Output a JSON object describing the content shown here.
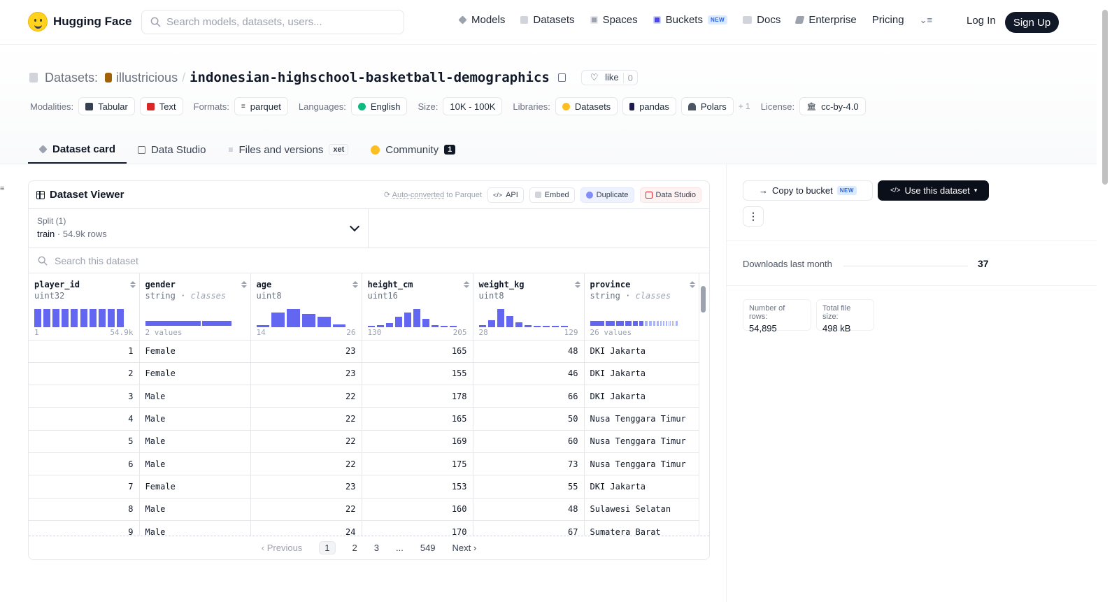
{
  "nav": {
    "brand": "Hugging Face",
    "search_placeholder": "Search models, datasets, users...",
    "links": [
      {
        "label": "Models",
        "icon": "models-icon"
      },
      {
        "label": "Datasets",
        "icon": "datasets-icon"
      },
      {
        "label": "Spaces",
        "icon": "spaces-icon"
      },
      {
        "label": "Buckets",
        "icon": "buckets-icon",
        "badge": "NEW"
      },
      {
        "label": "Docs",
        "icon": "docs-icon"
      },
      {
        "label": "Enterprise",
        "icon": "enterprise-icon"
      },
      {
        "label": "Pricing"
      }
    ],
    "login": "Log In",
    "signup": "Sign Up"
  },
  "header": {
    "kind": "Datasets:",
    "owner": "illustricious",
    "separator": "/",
    "name": "indonesian-highschool-basketball-demographics",
    "like_label": "like",
    "like_count": "0"
  },
  "tags": {
    "modalities_label": "Modalities:",
    "modalities": [
      "Tabular",
      "Text"
    ],
    "formats_label": "Formats:",
    "formats": [
      "parquet"
    ],
    "languages_label": "Languages:",
    "languages": [
      "English"
    ],
    "size_label": "Size:",
    "size": "10K - 100K",
    "libraries_label": "Libraries:",
    "libraries": [
      "Datasets",
      "pandas",
      "Polars"
    ],
    "libraries_more": "+ 1",
    "license_label": "License:",
    "license": "cc-by-4.0"
  },
  "tabs": {
    "card": "Dataset card",
    "studio": "Data Studio",
    "files": "Files and versions",
    "files_badge": "xet",
    "community": "Community",
    "community_count": "1"
  },
  "viewer": {
    "title": "Dataset Viewer",
    "auto_converted": "Auto-converted",
    "auto_converted_suffix": "to Parquet",
    "api": "API",
    "embed": "Embed",
    "duplicate": "Duplicate",
    "data_studio": "Data Studio",
    "split_label": "Split (1)",
    "split_value": "train",
    "split_dot": "·",
    "split_rows": "54.9k rows",
    "search_placeholder": "Search this dataset",
    "columns": [
      {
        "name": "player_id",
        "type": "uint32",
        "kind": "",
        "min": "1",
        "max": "54.9k",
        "hist": [
          1,
          1,
          1,
          1,
          1,
          1,
          1,
          1,
          1,
          1
        ]
      },
      {
        "name": "gender",
        "type": "string",
        "kind": "classes",
        "min": "2 values",
        "max": "",
        "classes": [
          0.65,
          0.35
        ]
      },
      {
        "name": "age",
        "type": "uint8",
        "kind": "",
        "min": "14",
        "max": "26",
        "hist": [
          0.1,
          0.8,
          1.0,
          0.7,
          0.55,
          0.15
        ]
      },
      {
        "name": "height_cm",
        "type": "uint16",
        "kind": "",
        "min": "130",
        "max": "205",
        "hist": [
          0.05,
          0.08,
          0.2,
          0.55,
          0.8,
          1.0,
          0.45,
          0.08,
          0.05,
          0.05
        ]
      },
      {
        "name": "weight_kg",
        "type": "uint8",
        "kind": "",
        "min": "28",
        "max": "129",
        "hist": [
          0.1,
          0.35,
          1.0,
          0.6,
          0.25,
          0.08,
          0.05,
          0.05,
          0.05,
          0.05
        ]
      },
      {
        "name": "province",
        "type": "string",
        "kind": "classes",
        "min": "26 values",
        "max": "",
        "classes": [
          0.18,
          0.12,
          0.1,
          0.09,
          0.07,
          0.06,
          0.05,
          0.05,
          0.04,
          0.04,
          0.03,
          0.03,
          0.03,
          0.02,
          0.02,
          0.02,
          0.02,
          0.01,
          0.01,
          0.01
        ]
      }
    ],
    "type_sep": "·",
    "rows": [
      [
        "1",
        "Female",
        "23",
        "165",
        "48",
        "DKI Jakarta"
      ],
      [
        "2",
        "Female",
        "23",
        "155",
        "46",
        "DKI Jakarta"
      ],
      [
        "3",
        "Male",
        "22",
        "178",
        "66",
        "DKI Jakarta"
      ],
      [
        "4",
        "Male",
        "22",
        "165",
        "50",
        "Nusa Tenggara Timur"
      ],
      [
        "5",
        "Male",
        "22",
        "169",
        "60",
        "Nusa Tenggara Timur"
      ],
      [
        "6",
        "Male",
        "22",
        "175",
        "73",
        "Nusa Tenggara Timur"
      ],
      [
        "7",
        "Female",
        "23",
        "153",
        "55",
        "DKI Jakarta"
      ],
      [
        "8",
        "Male",
        "22",
        "160",
        "48",
        "Sulawesi Selatan"
      ],
      [
        "9",
        "Male",
        "24",
        "170",
        "67",
        "Sumatera Barat"
      ]
    ],
    "pager": {
      "prev": "Previous",
      "pages": [
        "1",
        "2",
        "3",
        "...",
        "549"
      ],
      "current": "1",
      "next": "Next"
    }
  },
  "sidebar": {
    "copy_bucket": "Copy to bucket",
    "copy_bucket_badge": "NEW",
    "use_dataset": "Use this dataset",
    "downloads_label": "Downloads last month",
    "downloads_value": "37",
    "rows_label": "Number of rows:",
    "rows_value": "54,895",
    "size_label": "Total file size:",
    "size_value": "498 kB"
  },
  "colors": {
    "accent": "#6366f1",
    "dark": "#111827",
    "muted": "#6b7280"
  }
}
